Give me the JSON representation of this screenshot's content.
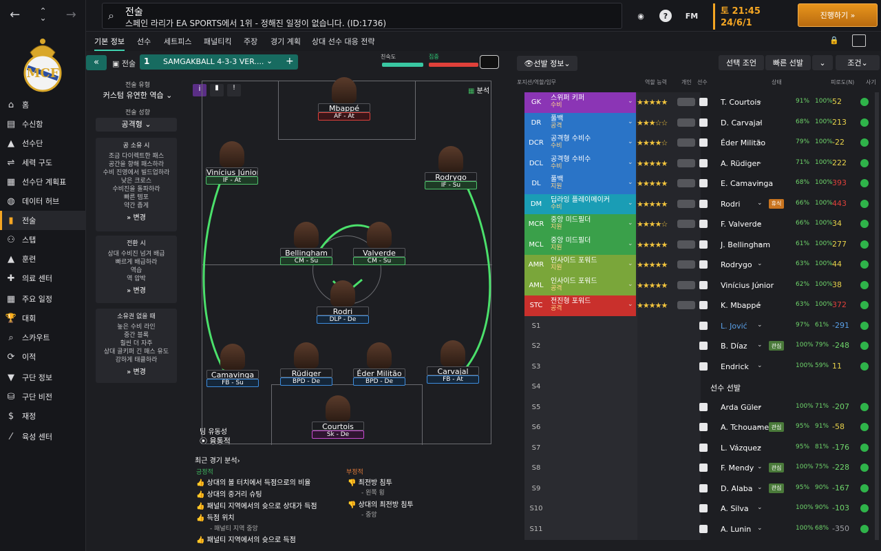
{
  "sidebar": {
    "items": [
      {
        "label": "홈",
        "icon": "home-icon"
      },
      {
        "label": "수신함",
        "icon": "inbox-icon"
      },
      {
        "label": "선수단",
        "icon": "shirt-icon"
      },
      {
        "label": "세력 구도",
        "icon": "hierarchy-icon"
      },
      {
        "label": "선수단 계획표",
        "icon": "clipboard-icon"
      },
      {
        "label": "데이터 허브",
        "icon": "data-hub-icon"
      },
      {
        "label": "전술",
        "icon": "tactics-icon",
        "active": true
      },
      {
        "label": "스탭",
        "icon": "staff-icon"
      },
      {
        "label": "훈련",
        "icon": "training-icon"
      },
      {
        "label": "의료 센터",
        "icon": "medical-icon"
      },
      {
        "label": "주요 일정",
        "icon": "calendar-icon"
      },
      {
        "label": "대회",
        "icon": "trophy-icon"
      },
      {
        "label": "스카우트",
        "icon": "scout-icon"
      },
      {
        "label": "이적",
        "icon": "transfer-icon"
      },
      {
        "label": "구단 정보",
        "icon": "club-info-icon"
      },
      {
        "label": "구단 비전",
        "icon": "vision-icon"
      },
      {
        "label": "재정",
        "icon": "finance-icon"
      },
      {
        "label": "육성 센터",
        "icon": "development-icon"
      }
    ]
  },
  "header": {
    "search_title": "전술",
    "search_subtitle": "스페인 라리가 EA SPORTS에서 1위 - 정해진 일정이 없습니다. (ID:1736)",
    "fm_label": "FM",
    "help_label": "?",
    "time": "토 21:45",
    "date": "24/6/1",
    "continue_label": "진행하기 »"
  },
  "tabs": [
    "기본 정보",
    "선수",
    "세트피스",
    "패널티킥",
    "주장",
    "경기 계획",
    "상대 선수 대응 전략"
  ],
  "tactic": {
    "label": "전술",
    "number": "1",
    "name": "SAMGAKBALL 4-3-3 VER....",
    "familiarity_label": "친숙도",
    "tc_label": "집중",
    "style_label": "전술 유형",
    "style_value": "커스텀 유연한 역습",
    "mentality_label": "전술 성향",
    "mentality_value": "공격형",
    "in_possession_title": "공 소유 시",
    "in_possession_lines": [
      "조금 다이렉트한 패스",
      "공간을 향해 패스하라",
      "수비 진영에서 빌드업하라",
      "낮은 크로스",
      "수비진을 돌파하라",
      "빠른 템포",
      "약간 좁게"
    ],
    "in_transition_title": "전환 시",
    "in_transition_lines": [
      "상대 수비진 넘겨 배급",
      "빠르게 배급하라",
      "역습",
      "역 압박"
    ],
    "out_possession_title": "소유권 없을 때",
    "out_possession_lines": [
      "높은 수비 라인",
      "중간 블록",
      "훨씬 더 자주",
      "상대 골키퍼 긴 패스 유도",
      "강하게 태클하라"
    ],
    "change_label": "변경",
    "analysis_label": "분석",
    "fluidity_label": "팀 유동성",
    "fluidity_value": "융통적"
  },
  "pitch_players": [
    {
      "name": "Mbappé",
      "role": "AF - At",
      "color": "red"
    },
    {
      "name": "Vinícius Júnior",
      "role": "IF - At",
      "color": "green"
    },
    {
      "name": "Rodrygo",
      "role": "IF - Su",
      "color": "green"
    },
    {
      "name": "Bellingham",
      "role": "CM - Su",
      "color": "green"
    },
    {
      "name": "Valverde",
      "role": "CM - Su",
      "color": "green"
    },
    {
      "name": "Rodri",
      "role": "DLP - De",
      "color": "blue"
    },
    {
      "name": "Camavinga",
      "role": "FB - Su",
      "color": "blue"
    },
    {
      "name": "Rüdiger",
      "role": "BPD - De",
      "color": "blue"
    },
    {
      "name": "Éder Militão",
      "role": "BPD - De",
      "color": "blue"
    },
    {
      "name": "Carvajal",
      "role": "FB - At",
      "color": "blue"
    },
    {
      "name": "Courtois",
      "role": "Sk - De",
      "color": "pink"
    }
  ],
  "analysis": {
    "title": "최근 경기 분석",
    "positive_title": "긍정적",
    "positives": [
      "상대의 볼 터치에서 득점으로의 비율",
      "상대의 중거리 슈팅",
      "패널티 지역에서의 슛으로 상대가 득점",
      "득점 위치",
      "패널티 지역에서의 슛으로 득점"
    ],
    "positive_sub": "- 패널티 지역 중앙",
    "negative_title": "부정적",
    "negatives": [
      "최전방 침투",
      "상대의 최전방 침투"
    ],
    "negative_subs": [
      "- 왼쪽 윙",
      "- 중앙"
    ]
  },
  "right": {
    "selection_info": "선발 정보",
    "select_cond": "선택 조언",
    "quick_pick": "빠른 선발",
    "cond_label": "조건",
    "columns": [
      "포지션/역할/임무",
      "역할 능력",
      "개인",
      "선수",
      "상태",
      "피로도(N)",
      "사기"
    ],
    "rows": [
      {
        "pos": "GK",
        "role": "스위퍼 키퍼",
        "duty": "수비",
        "stars": "★★★★★",
        "name": "T. Courtois",
        "cond": "91%",
        "fit": "100%",
        "pct": "52",
        "pctColor": "#e8d24a",
        "color": "#8b35b5"
      },
      {
        "pos": "DR",
        "role": "풀백",
        "duty": "공격",
        "stars": "★★★☆☆",
        "name": "D. Carvajal",
        "cond": "68%",
        "fit": "100%",
        "pct": "213",
        "pctColor": "#e8d24a",
        "color": "#2a74c7"
      },
      {
        "pos": "DCR",
        "role": "공격형 수비수",
        "duty": "수비",
        "stars": "★★★★☆",
        "name": "Éder Militão",
        "cond": "79%",
        "fit": "100%",
        "pct": "-22",
        "pctColor": "#e8d24a",
        "color": "#2a74c7"
      },
      {
        "pos": "DCL",
        "role": "공격형 수비수",
        "duty": "수비",
        "stars": "★★★★★",
        "name": "A. Rüdiger",
        "cond": "71%",
        "fit": "100%",
        "pct": "222",
        "pctColor": "#e8d24a",
        "color": "#2a74c7"
      },
      {
        "pos": "DL",
        "role": "풀백",
        "duty": "지원",
        "stars": "★★★★★",
        "name": "E. Camavinga",
        "cond": "68%",
        "fit": "100%",
        "pct": "393",
        "pctColor": "#e0403a",
        "color": "#2a74c7"
      },
      {
        "pos": "DM",
        "role": "딥라잉 플레이메이커",
        "duty": "수비",
        "stars": "★★★★★",
        "name": "Rodri",
        "cond": "66%",
        "fit": "100%",
        "pct": "443",
        "pctColor": "#e0403a",
        "color": "#1a9db5",
        "badge": "휴식"
      },
      {
        "pos": "MCR",
        "role": "중앙 미드필더",
        "duty": "지원",
        "stars": "★★★★☆",
        "name": "F. Valverde",
        "cond": "66%",
        "fit": "100%",
        "pct": "34",
        "pctColor": "#e8d24a",
        "color": "#3aa04a"
      },
      {
        "pos": "MCL",
        "role": "중앙 미드필더",
        "duty": "지원",
        "stars": "★★★★★",
        "name": "J. Bellingham",
        "cond": "61%",
        "fit": "100%",
        "pct": "277",
        "pctColor": "#e8d24a",
        "color": "#3aa04a"
      },
      {
        "pos": "AMR",
        "role": "인사이드 포워드",
        "duty": "지원",
        "stars": "★★★★★",
        "name": "Rodrygo",
        "cond": "63%",
        "fit": "100%",
        "pct": "44",
        "pctColor": "#e8d24a",
        "color": "#7aa63a"
      },
      {
        "pos": "AML",
        "role": "인사이드 포워드",
        "duty": "공격",
        "stars": "★★★★★",
        "name": "Vinícius Júnior",
        "cond": "62%",
        "fit": "100%",
        "pct": "38",
        "pctColor": "#e8d24a",
        "color": "#7aa63a"
      },
      {
        "pos": "STC",
        "role": "전진형 포워드",
        "duty": "공격",
        "stars": "★★★★★",
        "name": "K. Mbappé",
        "cond": "63%",
        "fit": "100%",
        "pct": "372",
        "pctColor": "#e0403a",
        "color": "#c9302c"
      },
      {
        "pos": "S1",
        "name": "L. Jović",
        "cond": "97%",
        "fit": "61%",
        "pct": "-291",
        "pctColor": "#5aa0e8",
        "nameColor": "#5aa0e8"
      },
      {
        "pos": "S2",
        "name": "B. Díaz",
        "cond": "100%",
        "fit": "79%",
        "pct": "-248",
        "pctColor": "#6fd66b",
        "badge": "관심"
      },
      {
        "pos": "S3",
        "name": "Endrick",
        "cond": "100%",
        "fit": "59%",
        "pct": "11",
        "pctColor": "#e8d24a"
      },
      {
        "pos": "S4",
        "name": "선수 선발",
        "cond": "",
        "fit": "",
        "pct": ""
      },
      {
        "pos": "S5",
        "name": "Arda Güler",
        "cond": "100%",
        "fit": "71%",
        "pct": "-207",
        "pctColor": "#6fd66b"
      },
      {
        "pos": "S6",
        "name": "A. Tchouameni",
        "cond": "95%",
        "fit": "91%",
        "pct": "-58",
        "pctColor": "#e8d24a",
        "badge": "관심"
      },
      {
        "pos": "S7",
        "name": "L. Vázquez",
        "cond": "95%",
        "fit": "81%",
        "pct": "-176",
        "pctColor": "#6fd66b"
      },
      {
        "pos": "S8",
        "name": "F. Mendy",
        "cond": "100%",
        "fit": "75%",
        "pct": "-228",
        "pctColor": "#6fd66b",
        "badge": "관심"
      },
      {
        "pos": "S9",
        "name": "D. Alaba",
        "cond": "95%",
        "fit": "90%",
        "pct": "-167",
        "pctColor": "#6fd66b",
        "badge": "관심"
      },
      {
        "pos": "S10",
        "name": "A. Silva",
        "cond": "100%",
        "fit": "90%",
        "pct": "-103",
        "pctColor": "#6fd66b"
      },
      {
        "pos": "S11",
        "name": "A. Lunin",
        "cond": "100%",
        "fit": "68%",
        "pct": "-350",
        "pctColor": "#9fa0a5"
      }
    ]
  }
}
